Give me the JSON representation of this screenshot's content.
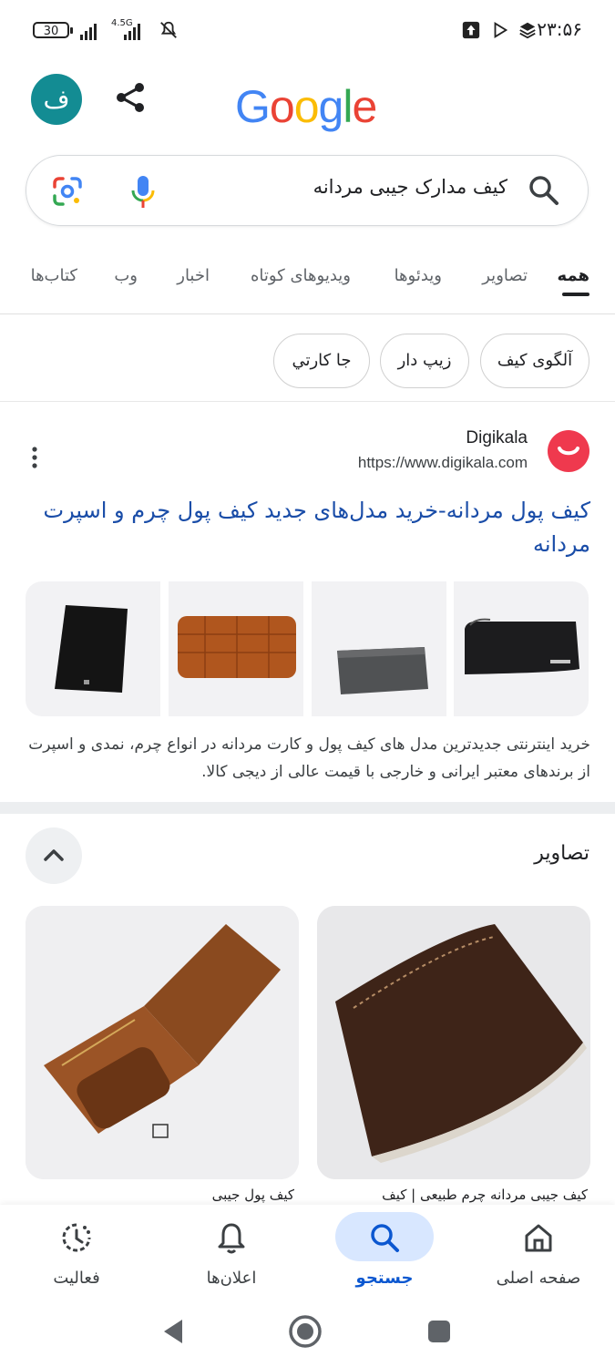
{
  "status_bar": {
    "battery": "30",
    "network": "4.5G",
    "time": "۲۳:۵۶",
    "icons": [
      "upload-icon",
      "play-store-icon",
      "layers-icon",
      "notifications-off-icon",
      "signal-icon"
    ]
  },
  "header": {
    "avatar_letter": "ف",
    "share_icon": "share-icon",
    "logo": [
      "G",
      "o",
      "o",
      "g",
      "l",
      "e"
    ],
    "logo_colors": [
      "#4285F4",
      "#EA4335",
      "#FBBC05",
      "#4285F4",
      "#34A853",
      "#EA4335"
    ]
  },
  "search": {
    "query": "کیف مدارک جیبی مردانه",
    "icons": [
      "search-icon",
      "mic-icon",
      "lens-icon"
    ]
  },
  "tabs": [
    {
      "label": "همه",
      "active": true
    },
    {
      "label": "تصاویر"
    },
    {
      "label": "ویدئوها"
    },
    {
      "label": "ویدیوهای کوتاه"
    },
    {
      "label": "اخبار"
    },
    {
      "label": "وب"
    },
    {
      "label": "کتاب‌ها"
    }
  ],
  "chips": [
    "آلگوی کیف",
    "زیپ دار",
    "جا کارتي"
  ],
  "result": {
    "site_name": "Digikala",
    "url": "https://www.digikala.com",
    "title": "کیف پول مردانه-خرید مدل‌های جدید کیف پول چرم و اسپرت مردانه",
    "snippet": "خرید اینترنتی جدیدترین مدل های کیف پول و کارت مردانه در انواع چرم، نمدی و اسپرت از برندهای معتبر ایرانی و خارجی با قیمت عالی از دیجی کالا.",
    "brand_color": "#ef394e"
  },
  "images_section": {
    "heading": "تصاویر",
    "items": [
      {
        "caption": "کیف جیبی مردانه چرم طبیعی | کیف"
      },
      {
        "caption": "کیف پول جیبی"
      }
    ]
  },
  "bottom_nav": [
    {
      "label": "صفحه اصلی",
      "icon": "home-icon"
    },
    {
      "label": "جستجو",
      "icon": "search-icon",
      "active": true
    },
    {
      "label": "اعلان‌ها",
      "icon": "bell-icon"
    },
    {
      "label": "فعالیت",
      "icon": "activity-icon"
    }
  ],
  "colors": {
    "accent": "#0b57d0",
    "link": "#1a4da8",
    "active_pill": "#d8e7ff",
    "avatar_bg": "#138c93"
  }
}
